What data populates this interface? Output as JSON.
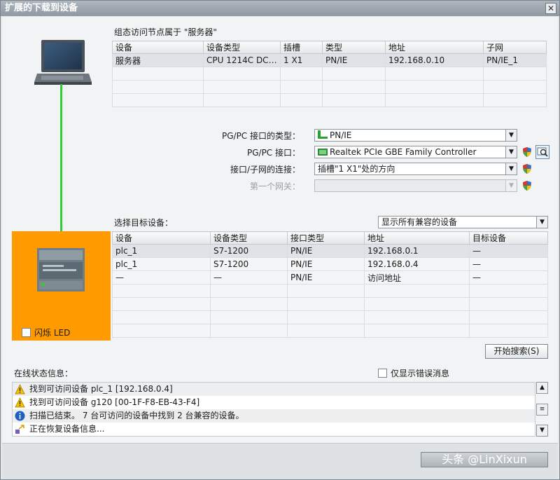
{
  "window": {
    "title": "扩展的下载到设备",
    "close_glyph": "✕"
  },
  "config_section": {
    "title": "组态访问节点属于 \"服务器\"",
    "columns": [
      "设备",
      "设备类型",
      "插槽",
      "类型",
      "地址",
      "子网"
    ],
    "rows": [
      [
        "服务器",
        "CPU 1214C DC/D...",
        "1 X1",
        "PN/IE",
        "192.168.0.10",
        "PN/IE_1"
      ],
      [
        "",
        "",
        "",
        "",
        "",
        ""
      ],
      [
        "",
        "",
        "",
        "",
        "",
        ""
      ],
      [
        "",
        "",
        "",
        "",
        "",
        ""
      ]
    ]
  },
  "interface": {
    "type_label": "PG/PC 接口的类型：",
    "type_value": "PN/IE",
    "iface_label": "PG/PC 接口：",
    "iface_value": "Realtek PCIe GBE Family Controller",
    "conn_label": "接口/子网的连接：",
    "conn_value": "插槽\"1 X1\"处的方向",
    "gateway_label": "第一个网关：",
    "gateway_value": ""
  },
  "target_section": {
    "title": "选择目标设备：",
    "filter_value": "显示所有兼容的设备",
    "columns": [
      "设备",
      "设备类型",
      "接口类型",
      "地址",
      "目标设备"
    ],
    "rows": [
      [
        "plc_1",
        "S7-1200",
        "PN/IE",
        "192.168.0.1",
        "—"
      ],
      [
        "plc_1",
        "S7-1200",
        "PN/IE",
        "192.168.0.4",
        "—"
      ],
      [
        "—",
        "—",
        "PN/IE",
        "访问地址",
        "—"
      ],
      [
        "",
        "",
        "",
        "",
        ""
      ],
      [
        "",
        "",
        "",
        "",
        ""
      ],
      [
        "",
        "",
        "",
        "",
        ""
      ],
      [
        "",
        "",
        "",
        "",
        ""
      ]
    ]
  },
  "flash_led_label": "闪烁 LED",
  "start_search_label": "开始搜索(S)",
  "status_section": {
    "title": "在线状态信息：",
    "only_errors_label": "仅显示错误消息",
    "messages": [
      {
        "icon": "warning-icon",
        "text": "找到可访问设备 plc_1 [192.168.0.4]"
      },
      {
        "icon": "warning-icon",
        "text": "找到可访问设备 g120 [00-1F-F8-EB-43-F4]"
      },
      {
        "icon": "info-icon",
        "text": "扫描已结束。 7 台可访问的设备中找到 2 台兼容的设备。"
      },
      {
        "icon": "progress-icon",
        "text": "正在恢复设备信息..."
      }
    ]
  },
  "footer": {
    "watermark": "头条 @LinXixun"
  },
  "colors": {
    "orange_panel": "#ff9a00",
    "connection_line": "#33cc33",
    "warning": "#f5c400",
    "info": "#1f5fbf"
  }
}
